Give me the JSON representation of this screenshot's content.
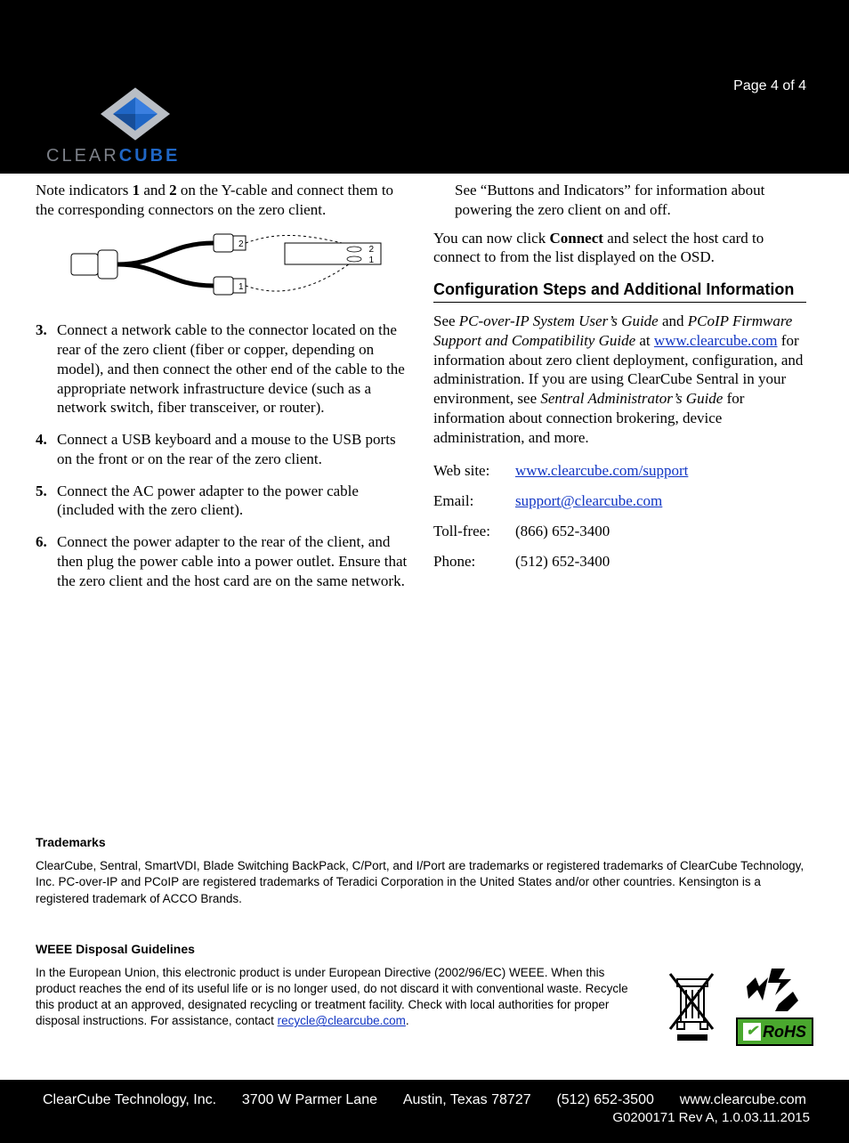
{
  "header": {
    "page_label": "Page 4 of 4",
    "logo_clear": "CLEAR",
    "logo_cube": "CUBE"
  },
  "left": {
    "intro_pre": "Note indicators ",
    "intro_1": "1",
    "intro_mid": " and ",
    "intro_2": "2",
    "intro_post": " on the Y-cable and connect them to the corresponding connectors on the zero client.",
    "fig": {
      "label1": "1",
      "label2": "2",
      "port1": "1",
      "port2": "2"
    },
    "steps": [
      {
        "n": "3.",
        "t": "Connect a network cable to the connector located on the rear of the zero client (fiber or copper, depending on model), and then connect the other end of the cable to the appropriate network infrastructure device (such as a network switch, fiber transceiver, or router)."
      },
      {
        "n": "4.",
        "t": "Connect a USB keyboard and a mouse to the USB ports on the front or on the rear of the zero client."
      },
      {
        "n": "5.",
        "t": "Connect the AC power adapter to the power cable (included with the zero client)."
      },
      {
        "n": "6.",
        "t": "Connect the power adapter to the rear of the client, and then plug the power cable into a power outlet. Ensure that the zero client and the host card are on the same network."
      }
    ]
  },
  "right": {
    "p1": "See “Buttons and Indicators” for information about powering the zero client on and off.",
    "p2_pre": "You can now click ",
    "p2_bold": "Connect",
    "p2_post": " and select the host card to connect to from the list displayed on the OSD.",
    "section_heading": "Configuration Steps and Additional Information",
    "cfg_pre": "See ",
    "cfg_doc1": "PC-over-IP System User’s Guide",
    "cfg_and": " and ",
    "cfg_doc2": "PCoIP Firmware Support and Compatibility Guide",
    "cfg_at": " at ",
    "cfg_link": "www.clearcube.com",
    "cfg_mid": " for information about zero client deployment, configuration, and administration. If you are using ClearCube Sentral in your environment, see ",
    "cfg_doc3": "Sentral Administrator’s Guide",
    "cfg_post": " for information about connection brokering, device administration, and more.",
    "contact": {
      "website_label": "Web site:",
      "website_value": "www.clearcube.com/support",
      "email_label": "Email:",
      "email_value": "support@clearcube.com",
      "tollfree_label": "Toll-free:",
      "tollfree_value": "(866) 652-3400",
      "phone_label": "Phone:",
      "phone_value": "(512) 652-3400"
    }
  },
  "legal": {
    "trademarks_heading": "Trademarks",
    "trademarks_body": "ClearCube, Sentral, SmartVDI, Blade Switching BackPack, C/Port, and I/Port are trademarks or registered trademarks of ClearCube Technology, Inc. PC-over-IP and PCoIP are registered trademarks of Teradici Corporation in the United States and/or other countries. Kensington is a registered trademark of ACCO Brands.",
    "weee_heading": "WEEE Disposal Guidelines",
    "weee_body_pre": "In the European Union, this electronic product is under European Directive (2002/96/EC) WEEE. When this product reaches the end of its useful life or is no longer used, do not discard it with conventional waste. Recycle this product at an approved, designated recycling or treatment facility. Check with local authorities for proper disposal instructions. For assistance, contact ",
    "weee_link": "recycle@clearcube.com",
    "weee_body_post": ".",
    "rohs_label": "RoHS"
  },
  "footer": {
    "company": "ClearCube Technology, Inc.",
    "address1": "3700 W Parmer Lane",
    "address2": "Austin, Texas 78727",
    "phone": "(512) 652-3500",
    "url": "www.clearcube.com",
    "docrev": "G0200171 Rev A, 1.0.03.11.2015"
  }
}
